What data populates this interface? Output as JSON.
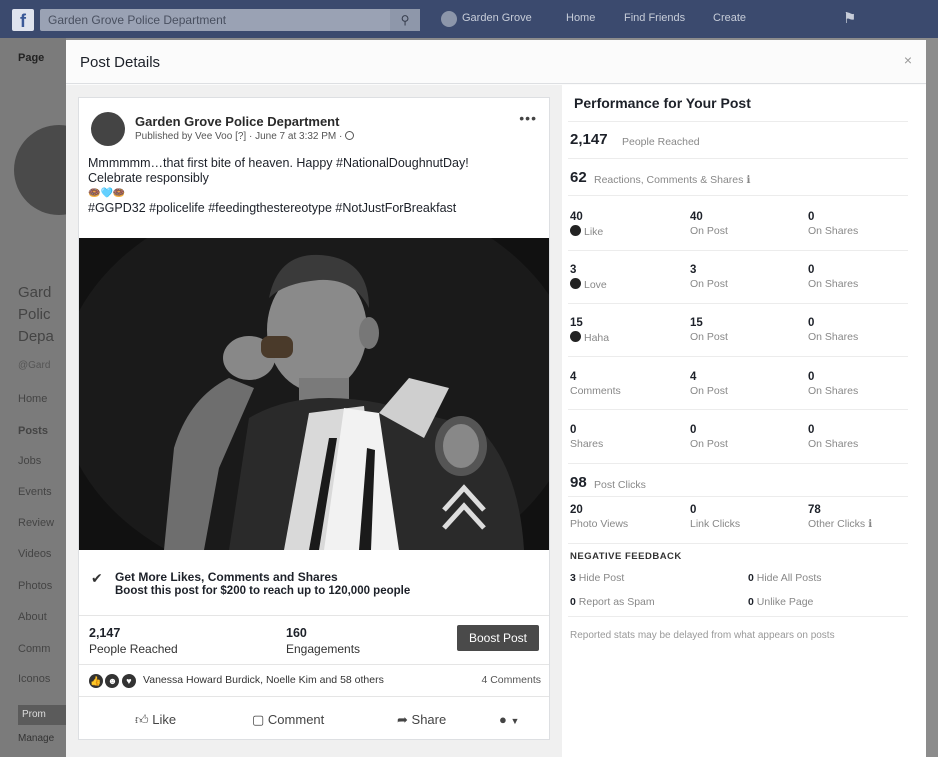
{
  "fb": {
    "logo": "f",
    "search_value": "Garden Grove Police Department",
    "search_icon": "search-icon",
    "nav_profile": "Garden Grove",
    "nav_home": "Home",
    "nav_find_friends": "Find Friends",
    "nav_create": "Create"
  },
  "background": {
    "tab": "Page",
    "page_name_lines": [
      "Gard",
      "Polic",
      "Depa"
    ],
    "handle": "@Gard",
    "menu": [
      "Home",
      "Posts",
      "Jobs",
      "Events",
      "Review",
      "Videos",
      "Photos",
      "About",
      "Comm",
      "Iconos"
    ],
    "promote": "Prom",
    "manage": "Manage"
  },
  "modal": {
    "title": "Post Details",
    "close": "×"
  },
  "post": {
    "page_name": "Garden Grove Police Department",
    "meta": "Published by Vee Voo [?] · June 7 at 3:32 PM · ",
    "text_line1": "Mmmmmm…that first bite of heaven. Happy #NationalDoughnutDay!",
    "text_line2": "Celebrate responsibly",
    "text_line3": "🍩🩵🍩",
    "text_line4": "#GGPD32 #policelife #feedingthestereotype #NotJustForBreakfast",
    "boost_title": "Get More Likes, Comments and Shares",
    "boost_sub": "Boost this post for $200 to reach up to 120,000 people",
    "reached_value": "2,147",
    "reached_label": "People Reached",
    "engagements_value": "160",
    "engagements_label": "Engagements",
    "boost_button": "Boost Post",
    "reaction_names": "Vanessa Howard Burdick, Noelle Kim and 58 others",
    "comments_count": "4 Comments",
    "like": "Like",
    "comment": "Comment",
    "share": "Share"
  },
  "perf": {
    "title": "Performance for Your Post",
    "reached_value": "2,147",
    "reached_label": "People Reached",
    "reactions_value": "62",
    "reactions_label": "Reactions, Comments & Shares",
    "rows": [
      {
        "total": "40",
        "label": "Like",
        "on_post": "40",
        "on_post_label": "On Post",
        "on_shares": "0",
        "on_shares_label": "On Shares"
      },
      {
        "total": "3",
        "label": "Love",
        "on_post": "3",
        "on_post_label": "On Post",
        "on_shares": "0",
        "on_shares_label": "On Shares"
      },
      {
        "total": "15",
        "label": "Haha",
        "on_post": "15",
        "on_post_label": "On Post",
        "on_shares": "0",
        "on_shares_label": "On Shares"
      },
      {
        "total": "4",
        "label": "Comments",
        "on_post": "4",
        "on_post_label": "On Post",
        "on_shares": "0",
        "on_shares_label": "On Shares"
      },
      {
        "total": "0",
        "label": "Shares",
        "on_post": "0",
        "on_post_label": "On Post",
        "on_shares": "0",
        "on_shares_label": "On Shares"
      }
    ],
    "clicks_value": "98",
    "clicks_label": "Post Clicks",
    "photo_views": "20",
    "photo_views_label": "Photo Views",
    "link_clicks": "0",
    "link_clicks_label": "Link Clicks",
    "other_clicks": "78",
    "other_clicks_label": "Other Clicks",
    "neg_title": "NEGATIVE FEEDBACK",
    "hide_post_value": "3",
    "hide_post_label": "Hide Post",
    "hide_all_value": "0",
    "hide_all_label": "Hide All Posts",
    "spam_value": "0",
    "spam_label": "Report as Spam",
    "unlike_value": "0",
    "unlike_label": "Unlike Page",
    "footnote": "Reported stats may be delayed from what appears on posts"
  }
}
